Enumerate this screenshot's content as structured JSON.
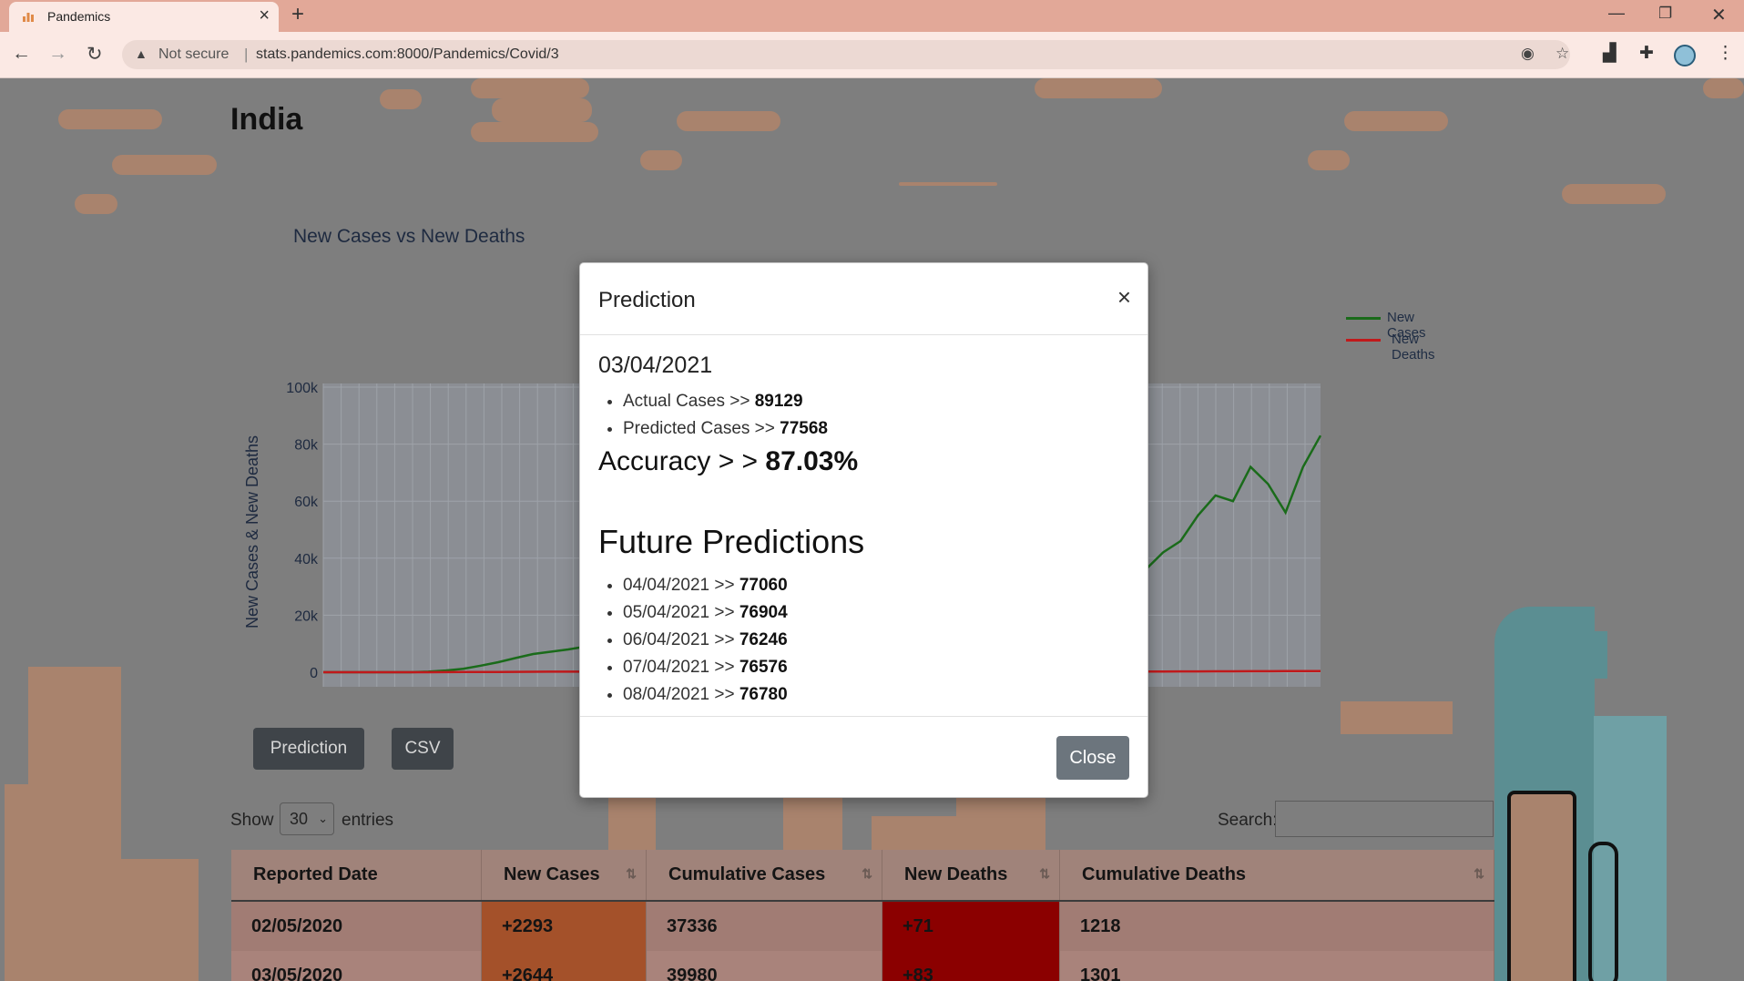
{
  "browser": {
    "tab_title": "Pandemics",
    "not_secure": "Not secure",
    "url": "stats.pandemics.com:8000/Pandemics/Covid/3"
  },
  "page": {
    "country": "India",
    "chart_title": "New Cases vs New Deaths",
    "buttons": {
      "prediction": "Prediction",
      "csv": "CSV"
    },
    "show_label": "Show",
    "entries_value": "30",
    "entries_label": "entries",
    "search_label": "Search:"
  },
  "chart_data": {
    "type": "line",
    "title": "New Cases vs New Deaths",
    "ylabel": "New Cases & New Deaths",
    "ylim": [
      0,
      100000
    ],
    "yticks": [
      "0",
      "20k",
      "40k",
      "60k",
      "80k",
      "100k"
    ],
    "legend_position": "top-right",
    "grid": true,
    "series": [
      {
        "name": "New Cases",
        "color": "#1a6b1a",
        "values": [
          0,
          0,
          0,
          0,
          0,
          0,
          200,
          600,
          1200,
          2300,
          3500,
          5000,
          6400,
          7200,
          8000,
          9000,
          10000,
          10500,
          11000,
          12000,
          13000,
          14000,
          14500,
          15000,
          16000,
          17000,
          17500,
          18000,
          18000,
          17000,
          13000,
          11000,
          15000,
          10000,
          12000,
          9000,
          11000,
          10000,
          12000,
          11000,
          13000,
          12000,
          14000,
          16000,
          18000,
          22000,
          28000,
          36000,
          42000,
          46000,
          55000,
          62000,
          60000,
          72000,
          66000,
          56000,
          72000,
          83000
        ]
      },
      {
        "name": "New Deaths",
        "color": "#c0191b",
        "values": [
          0,
          0,
          0,
          0,
          0,
          0,
          10,
          20,
          50,
          70,
          90,
          120,
          150,
          180,
          200,
          220,
          240,
          260,
          280,
          300,
          320,
          340,
          360,
          380,
          400,
          380,
          360,
          340,
          320,
          300,
          200,
          150,
          120,
          110,
          100,
          100,
          100,
          100,
          100,
          100,
          100,
          110,
          120,
          130,
          150,
          180,
          200,
          220,
          250,
          280,
          300,
          320,
          330,
          350,
          360,
          380,
          400,
          420
        ]
      }
    ]
  },
  "modal": {
    "title": "Prediction",
    "date": "03/04/2021",
    "actual_label": "Actual Cases >> ",
    "actual_value": "89129",
    "predicted_label": "Predicted Cases >> ",
    "predicted_value": "77568",
    "accuracy_label": "Accuracy > > ",
    "accuracy_value": "87.03%",
    "future_title": "Future Predictions",
    "future": [
      {
        "date": "04/04/2021 >> ",
        "value": "77060"
      },
      {
        "date": "05/04/2021 >> ",
        "value": "76904"
      },
      {
        "date": "06/04/2021 >> ",
        "value": "76246"
      },
      {
        "date": "07/04/2021 >> ",
        "value": "76576"
      },
      {
        "date": "08/04/2021 >> ",
        "value": "76780"
      }
    ],
    "close_label": "Close"
  },
  "table": {
    "headers": [
      "Reported Date",
      "New Cases",
      "Cumulative Cases",
      "New Deaths",
      "Cumulative Deaths"
    ],
    "rows": [
      [
        "02/05/2020",
        "+2293",
        "37336",
        "+71",
        "1218"
      ],
      [
        "03/05/2020",
        "+2644",
        "39980",
        "+83",
        "1301"
      ]
    ]
  }
}
